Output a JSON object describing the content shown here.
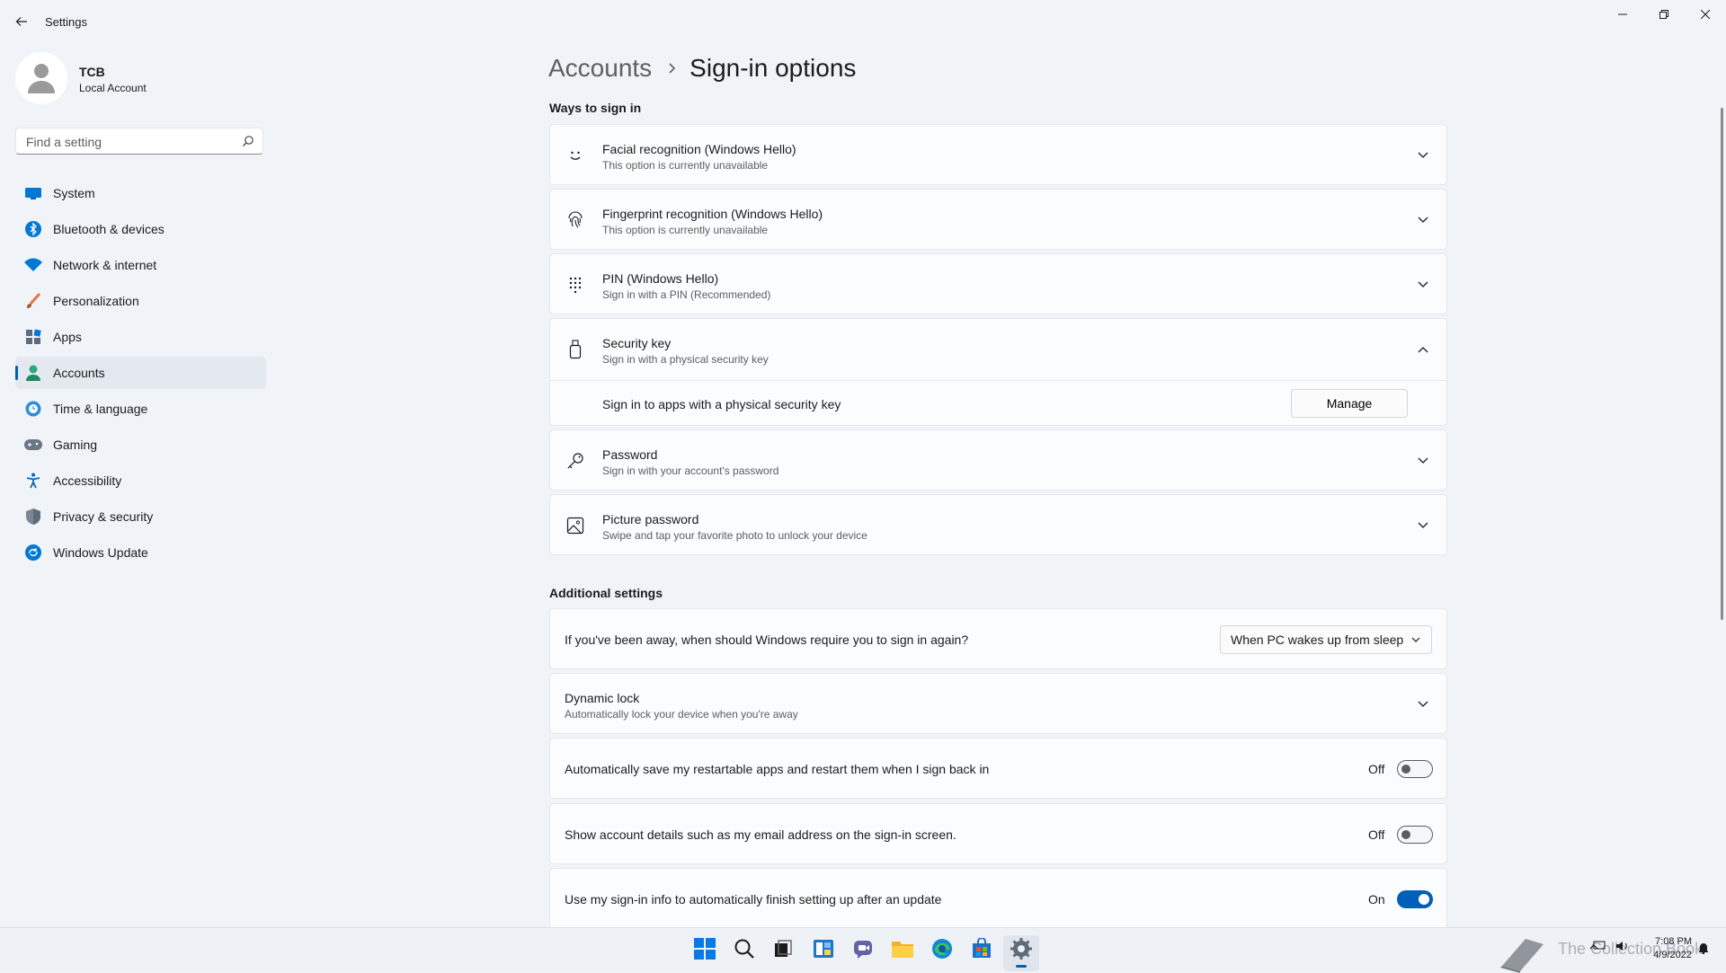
{
  "window": {
    "title": "Settings",
    "controls": [
      "minimize",
      "restore",
      "close"
    ]
  },
  "profile": {
    "name": "TCB",
    "account_type": "Local Account"
  },
  "search": {
    "placeholder": "Find a setting",
    "value": ""
  },
  "nav": {
    "items": [
      {
        "label": "System",
        "icon": "monitor-icon",
        "active": false
      },
      {
        "label": "Bluetooth & devices",
        "icon": "bluetooth-icon",
        "active": false
      },
      {
        "label": "Network & internet",
        "icon": "wifi-icon",
        "active": false
      },
      {
        "label": "Personalization",
        "icon": "brush-icon",
        "active": false
      },
      {
        "label": "Apps",
        "icon": "apps-icon",
        "active": false
      },
      {
        "label": "Accounts",
        "icon": "person-icon",
        "active": true
      },
      {
        "label": "Time & language",
        "icon": "globe-clock-icon",
        "active": false
      },
      {
        "label": "Gaming",
        "icon": "gamepad-icon",
        "active": false
      },
      {
        "label": "Accessibility",
        "icon": "accessibility-icon",
        "active": false
      },
      {
        "label": "Privacy & security",
        "icon": "shield-icon",
        "active": false
      },
      {
        "label": "Windows Update",
        "icon": "update-icon",
        "active": false
      }
    ]
  },
  "breadcrumb": {
    "parent": "Accounts",
    "separator": "›",
    "current": "Sign-in options"
  },
  "ways_to_sign_in": {
    "title": "Ways to sign in",
    "options": [
      {
        "title": "Facial recognition (Windows Hello)",
        "subtitle": "This option is currently unavailable",
        "icon": "face-icon",
        "expanded": false
      },
      {
        "title": "Fingerprint recognition (Windows Hello)",
        "subtitle": "This option is currently unavailable",
        "icon": "fingerprint-icon",
        "expanded": false
      },
      {
        "title": "PIN (Windows Hello)",
        "subtitle": "Sign in with a PIN (Recommended)",
        "icon": "keypad-icon",
        "expanded": false
      },
      {
        "title": "Security key",
        "subtitle": "Sign in with a physical security key",
        "icon": "usb-key-icon",
        "expanded": true
      },
      {
        "title": "Password",
        "subtitle": "Sign in with your account's password",
        "icon": "key-icon",
        "expanded": false
      },
      {
        "title": "Picture password",
        "subtitle": "Swipe and tap your favorite photo to unlock your device",
        "icon": "picture-icon",
        "expanded": false
      }
    ],
    "security_key_detail": {
      "label": "Sign in to apps with a physical security key",
      "button": "Manage"
    }
  },
  "additional_settings": {
    "title": "Additional settings",
    "away": {
      "label": "If you've been away, when should Windows require you to sign in again?",
      "selected": "When PC wakes up from sleep"
    },
    "dynamic_lock": {
      "title": "Dynamic lock",
      "subtitle": "Automatically lock your device when you're away"
    },
    "toggles": [
      {
        "label": "Automatically save my restartable apps and restart them when I sign back in",
        "state": "Off"
      },
      {
        "label": "Show account details such as my email address on the sign-in screen.",
        "state": "Off"
      },
      {
        "label": "Use my sign-in info to automatically finish setting up after an update",
        "state": "On"
      }
    ]
  },
  "taskbar": {
    "apps": [
      "start-icon",
      "search-icon",
      "task-view-icon",
      "widgets-icon",
      "chat-icon",
      "file-explorer-icon",
      "edge-icon",
      "store-icon",
      "settings-icon"
    ],
    "active_app": "settings-icon",
    "time": "7:08 PM",
    "date": "4/9/2022",
    "watermark": "The Collection Book"
  },
  "colors": {
    "accent": "#005fb8",
    "background": "#f0f4f9",
    "card": "#fbfcfd"
  }
}
